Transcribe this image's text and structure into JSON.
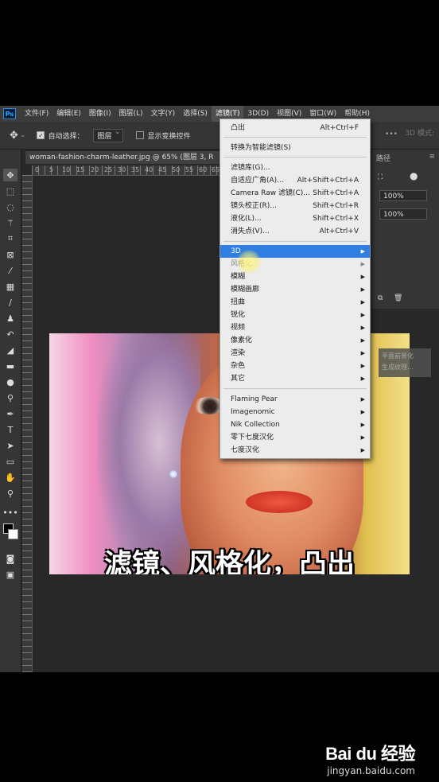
{
  "menubar": {
    "logo": "Ps",
    "items": [
      "文件(F)",
      "编辑(E)",
      "图像(I)",
      "图层(L)",
      "文字(Y)",
      "选择(S)",
      "滤镜(T)",
      "3D(D)",
      "视图(V)",
      "窗口(W)",
      "帮助(H)"
    ],
    "active": "滤镜(T)"
  },
  "options": {
    "auto_select_label": "自动选择：",
    "auto_select_value": "图层",
    "show_transform_label": "显示变换控件",
    "mode_3d": "3D 模式:"
  },
  "document": {
    "tab_title": "woman-fashion-charm-leather.jpg @ 65% (图层 3, R",
    "ruler_labels": [
      "0",
      "5",
      "10",
      "15",
      "20",
      "25",
      "30",
      "35",
      "40",
      "45",
      "50",
      "55",
      "60",
      "65"
    ]
  },
  "right_panel": {
    "tab": "路径",
    "zoom1": "100%",
    "zoom2": "100%"
  },
  "tooltip": {
    "lines": [
      "平面前景化",
      "生成纹理..."
    ]
  },
  "filter_menu": {
    "items": [
      {
        "label": "凸出",
        "shortcut": "Alt+Ctrl+F",
        "submenu": false
      },
      {
        "label": "转换为智能滤镜(S)",
        "shortcut": "",
        "submenu": false
      },
      {
        "label": "滤镜库(G)...",
        "shortcut": "",
        "submenu": false
      },
      {
        "label": "自适应广角(A)...",
        "shortcut": "Alt+Shift+Ctrl+A",
        "submenu": false
      },
      {
        "label": "Camera Raw 滤镜(C)...",
        "shortcut": "Shift+Ctrl+A",
        "submenu": false
      },
      {
        "label": "镜头校正(R)...",
        "shortcut": "Shift+Ctrl+R",
        "submenu": false
      },
      {
        "label": "液化(L)...",
        "shortcut": "Shift+Ctrl+X",
        "submenu": false
      },
      {
        "label": "消失点(V)...",
        "shortcut": "Alt+Ctrl+V",
        "submenu": false
      },
      {
        "label": "3D",
        "shortcut": "",
        "submenu": true
      },
      {
        "label": "风格化",
        "shortcut": "",
        "submenu": true
      },
      {
        "label": "模糊",
        "shortcut": "",
        "submenu": true
      },
      {
        "label": "模糊画廊",
        "shortcut": "",
        "submenu": true
      },
      {
        "label": "扭曲",
        "shortcut": "",
        "submenu": true
      },
      {
        "label": "锐化",
        "shortcut": "",
        "submenu": true
      },
      {
        "label": "视频",
        "shortcut": "",
        "submenu": true
      },
      {
        "label": "像素化",
        "shortcut": "",
        "submenu": true
      },
      {
        "label": "渲染",
        "shortcut": "",
        "submenu": true
      },
      {
        "label": "杂色",
        "shortcut": "",
        "submenu": true
      },
      {
        "label": "其它",
        "shortcut": "",
        "submenu": true
      },
      {
        "label": "Flaming Pear",
        "shortcut": "",
        "submenu": true
      },
      {
        "label": "Imagenomic",
        "shortcut": "",
        "submenu": true
      },
      {
        "label": "Nik Collection",
        "shortcut": "",
        "submenu": true
      },
      {
        "label": "零下七度汉化",
        "shortcut": "",
        "submenu": true
      },
      {
        "label": "七度汉化",
        "shortcut": "",
        "submenu": true
      }
    ],
    "highlighted": "3D",
    "arrow": "▶"
  },
  "caption": "滤镜、风格化，凸出",
  "watermark": {
    "logo": "Bai du 经验",
    "url": "jingyan.baidu.com"
  }
}
